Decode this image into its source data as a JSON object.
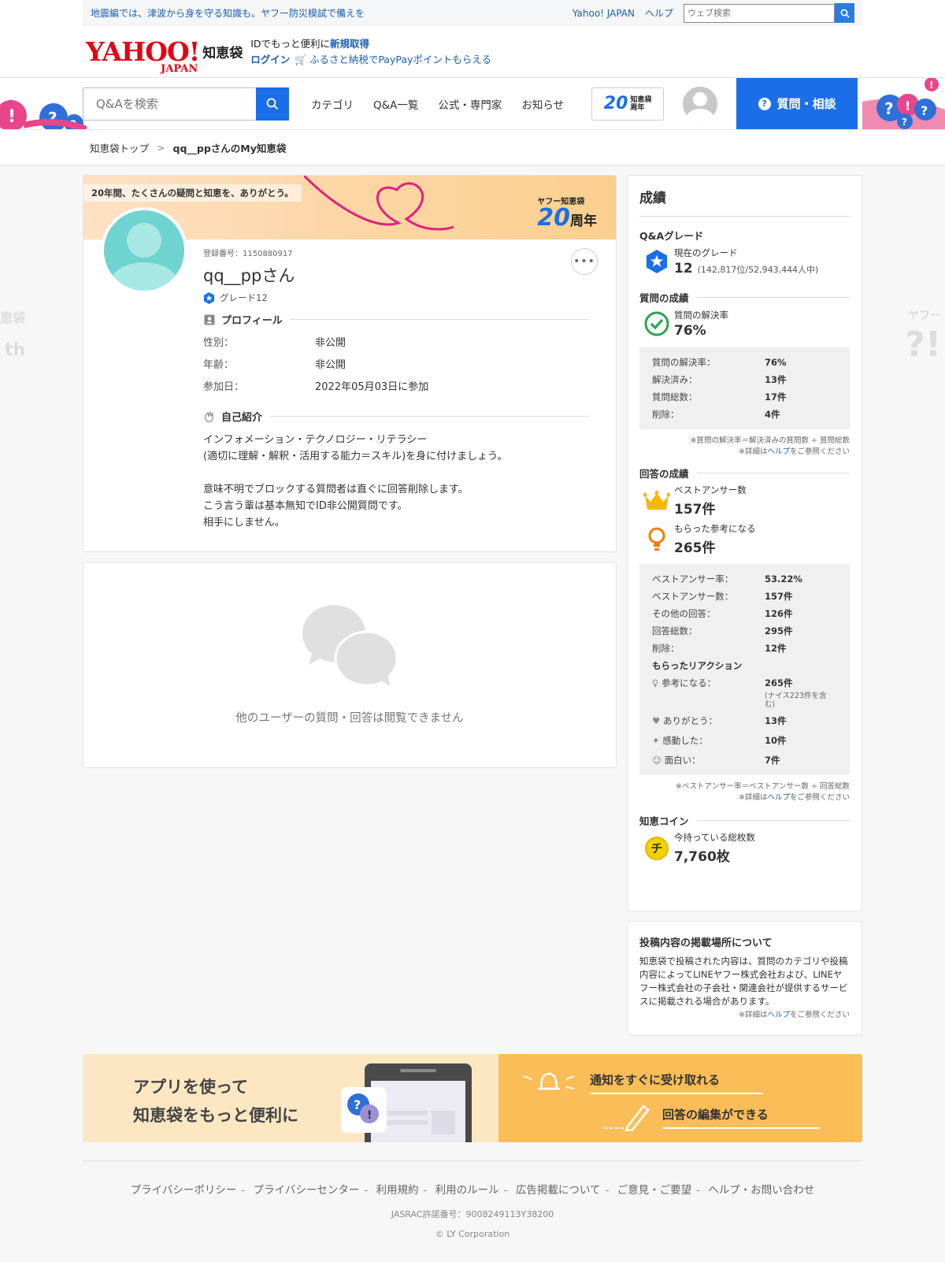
{
  "topstrip": {
    "alert": "地震編では、津波から身を守る知識も。ヤフー防災模試で備えを",
    "yahoo_japan": "Yahoo! JAPAN",
    "help": "ヘルプ",
    "websearch_placeholder": "ウェブ検索"
  },
  "masthead": {
    "logo_yahoo": "YAHOO!",
    "logo_japan": "JAPAN",
    "logo_chie": "知恵袋",
    "id_line_prefix": "IDでもっと便利に",
    "id_register": "新規取得",
    "login": "ログイン",
    "furusato": "ふるさと納税でPayPayポイントもらえる"
  },
  "nav": {
    "search_placeholder": "Q&Aを検索",
    "links": [
      "カテゴリ",
      "Q&A一覧",
      "公式・専門家",
      "お知らせ"
    ],
    "badge_num": "20",
    "badge_text_1": "知恵袋",
    "badge_text_2": "周年",
    "ask_button": "質問・相談"
  },
  "breadcrumb": {
    "top": "知恵袋トップ",
    "current": "qq__ppさんのMy知恵袋"
  },
  "profile": {
    "banner_text": "20年間、たくさんの疑問と知恵を、ありがとう。",
    "anniv_small": "ヤフー知恵袋",
    "anniv_num": "20",
    "anniv_suffix": "周年",
    "reg_no": "登録番号：1150880917",
    "username": "qq__ppさん",
    "grade": "グレード12",
    "profile_heading": "プロフィール",
    "rows": [
      {
        "k": "性別：",
        "v": "非公開"
      },
      {
        "k": "年齢：",
        "v": "非公開"
      },
      {
        "k": "参加日：",
        "v": "2022年05月03日に参加"
      }
    ],
    "intro_heading": "自己紹介",
    "intro": "インフォメーション・テクノロジー・リテラシー\n(適切に理解・解釈・活用する能力＝スキル)を身に付けましょう。\n\n意味不明でブロックする質問者は直ぐに回答削除します。\nこう言う輩は基本無知でID非公開質問です。\n相手にしません。"
  },
  "noview": {
    "text": "他のユーザーの質問・回答は閲覧できません"
  },
  "results": {
    "title": "成績",
    "qa_grade_heading": "Q&Aグレード",
    "current_grade_label": "現在のグレード",
    "current_grade_value": "12",
    "current_grade_rank": "(142,817位/52,943,444人中)",
    "question_heading": "質問の成績",
    "resolve_rate_label": "質問の解決率",
    "resolve_rate_value": "76%",
    "question_stats": [
      {
        "k": "質問の解決率：",
        "v": "76%"
      },
      {
        "k": "解決済み：",
        "v": "13件"
      },
      {
        "k": "質問総数：",
        "v": "17件"
      },
      {
        "k": "削除：",
        "v": "4件"
      }
    ],
    "question_note_1": "※質問の解決率＝解決済みの質問数 ÷ 質問総数",
    "question_note_2a": "※詳細は",
    "question_note_help": "ヘルプ",
    "question_note_2b": "をご参照ください",
    "answer_heading": "回答の成績",
    "best_label": "ベストアンサー数",
    "best_value": "157件",
    "ref_label": "もらった参考になる",
    "ref_value": "265件",
    "answer_stats": [
      {
        "k": "ベストアンサー率：",
        "v": "53.22%"
      },
      {
        "k": "ベストアンサー数：",
        "v": "157件"
      },
      {
        "k": "その他の回答：",
        "v": "126件"
      },
      {
        "k": "回答総数：",
        "v": "295件"
      },
      {
        "k": "削除：",
        "v": "12件"
      }
    ],
    "reaction_heading": "もらったリアクション",
    "reactions": [
      {
        "k": "参考になる：",
        "v": "265件",
        "sub": "(ナイス223件を含む)"
      },
      {
        "k": "ありがとう：",
        "v": "13件"
      },
      {
        "k": "感動した：",
        "v": "10件"
      },
      {
        "k": "面白い：",
        "v": "7件"
      }
    ],
    "answer_note_1": "※ベストアンサー率＝ベストアンサー数 ÷ 回答総数",
    "coin_heading": "知恵コイン",
    "coin_label": "今持っている総枚数",
    "coin_value": "7,760枚",
    "coin_icon_char": "チ"
  },
  "notice": {
    "title": "投稿内容の掲載場所について",
    "body": "知恵袋で投稿された内容は、質問のカテゴリや投稿内容によってLINEヤフー株式会社および、LINEヤフー株式会社の子会社・関連会社が提供するサービスに掲載される場合があります。"
  },
  "app_banner": {
    "text": "アプリを使って\n知恵袋をもっと便利に",
    "feature_1": "通知をすぐに受け取れる",
    "feature_2": "回答の編集ができる"
  },
  "footer": {
    "links": [
      "プライバシーポリシー",
      "プライバシーセンター",
      "利用規約",
      "利用のルール",
      "広告掲載について",
      "ご意見・ご要望",
      "ヘルプ・お問い合わせ"
    ],
    "jasrac": "JASRAC許諾番号：9008249113Y38200",
    "copyright": "© LY Corporation"
  },
  "colors": {
    "accent_blue": "#1a6fe8",
    "yahoo_red": "#e50012",
    "link_blue": "#1a5fb4"
  }
}
